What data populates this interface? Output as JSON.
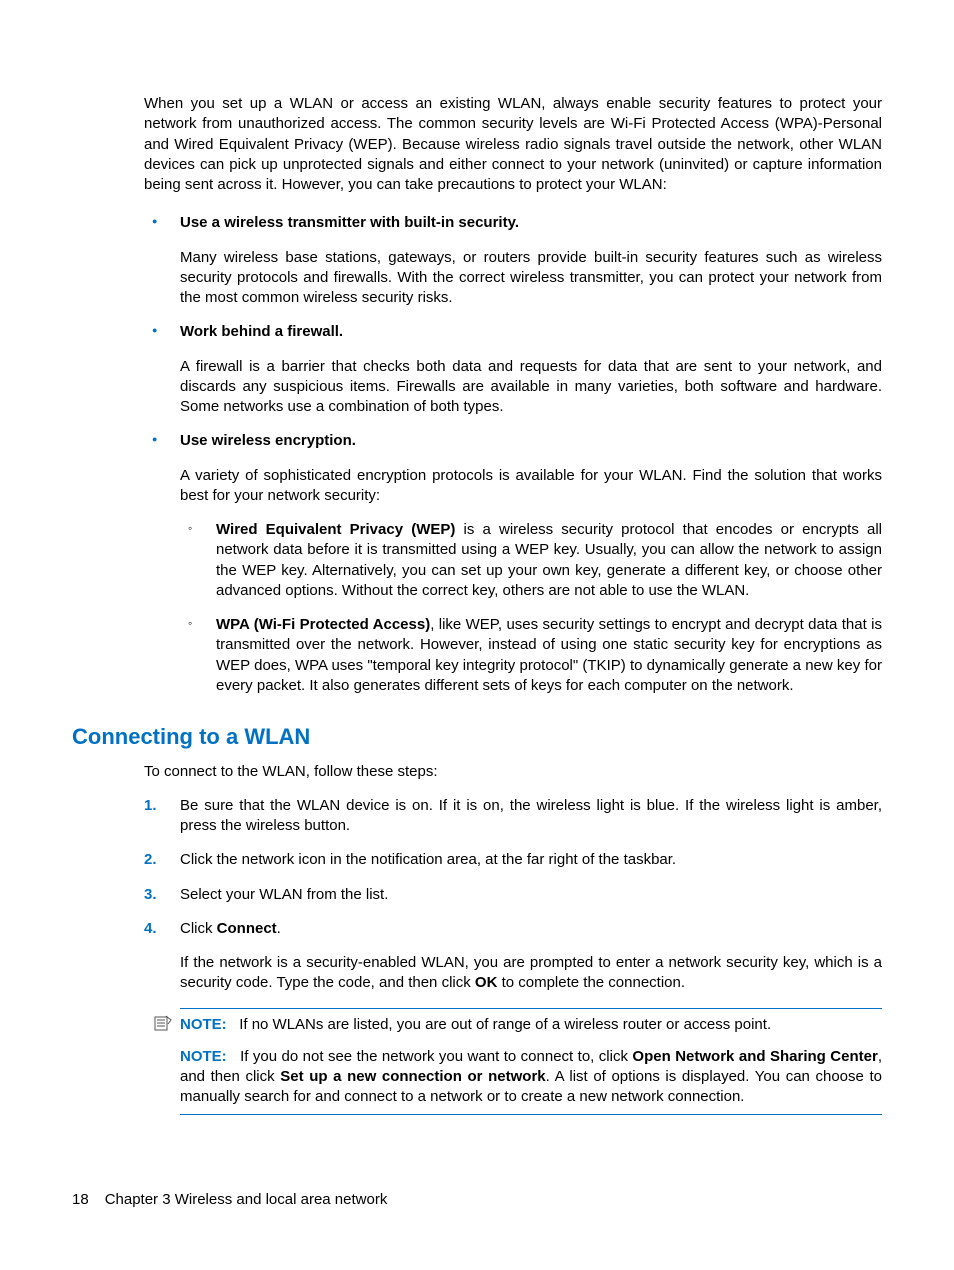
{
  "intro": "When you set up a WLAN or access an existing WLAN, always enable security features to protect your network from unauthorized access. The common security levels are Wi-Fi Protected Access (WPA)-Personal and Wired Equivalent Privacy (WEP). Because wireless radio signals travel outside the network, other WLAN devices can pick up unprotected signals and either connect to your network (uninvited) or capture information being sent across it. However, you can take precautions to protect your WLAN:",
  "bullets": [
    {
      "head": "Use a wireless transmitter with built-in security.",
      "body": "Many wireless base stations, gateways, or routers provide built-in security features such as wireless security protocols and firewalls. With the correct wireless transmitter, you can protect your network from the most common wireless security risks."
    },
    {
      "head": "Work behind a firewall.",
      "body": "A firewall is a barrier that checks both data and requests for data that are sent to your network, and discards any suspicious items. Firewalls are available in many varieties, both software and hardware. Some networks use a combination of both types."
    },
    {
      "head": "Use wireless encryption.",
      "body": "A variety of sophisticated encryption protocols is available for your WLAN. Find the solution that works best for your network security:",
      "sub": [
        {
          "bold": "Wired Equivalent Privacy (WEP)",
          "rest": " is a wireless security protocol that encodes or encrypts all network data before it is transmitted using a WEP key. Usually, you can allow the network to assign the WEP key. Alternatively, you can set up your own key, generate a different key, or choose other advanced options. Without the correct key, others are not able to use the WLAN."
        },
        {
          "bold": "WPA (Wi-Fi Protected Access)",
          "rest": ", like WEP, uses security settings to encrypt and decrypt data that is transmitted over the network. However, instead of using one static security key for encryptions as WEP does, WPA uses \"temporal key integrity protocol\" (TKIP) to dynamically generate a new key for every packet. It also generates different sets of keys for each computer on the network."
        }
      ]
    }
  ],
  "section_title": "Connecting to a WLAN",
  "section_intro": "To connect to the WLAN, follow these steps:",
  "steps": [
    {
      "num": "1.",
      "text": "Be sure that the WLAN device is on. If it is on, the wireless light is blue. If the wireless light is amber, press the wireless button."
    },
    {
      "num": "2.",
      "text": "Click the network icon in the notification area, at the far right of the taskbar."
    },
    {
      "num": "3.",
      "text": "Select your WLAN from the list."
    },
    {
      "num": "4.",
      "text_pre": "Click ",
      "bold": "Connect",
      "text_post": ".",
      "extra_pre": "If the network is a security-enabled WLAN, you are prompted to enter a network security key, which is a security code. Type the code, and then click ",
      "extra_bold": "OK",
      "extra_post": " to complete the connection."
    }
  ],
  "notes": [
    {
      "label": "NOTE:",
      "text": "If no WLANs are listed, you are out of range of a wireless router or access point."
    },
    {
      "label": "NOTE:",
      "pre": "If you do not see the network you want to connect to, click ",
      "b1": "Open Network and Sharing Center",
      "mid": ", and then click ",
      "b2": "Set up a new connection or network",
      "post": ". A list of options is displayed. You can choose to manually search for and connect to a network or to create a new network connection."
    }
  ],
  "footer": {
    "page": "18",
    "chapter": "Chapter 3   Wireless and local area network"
  }
}
